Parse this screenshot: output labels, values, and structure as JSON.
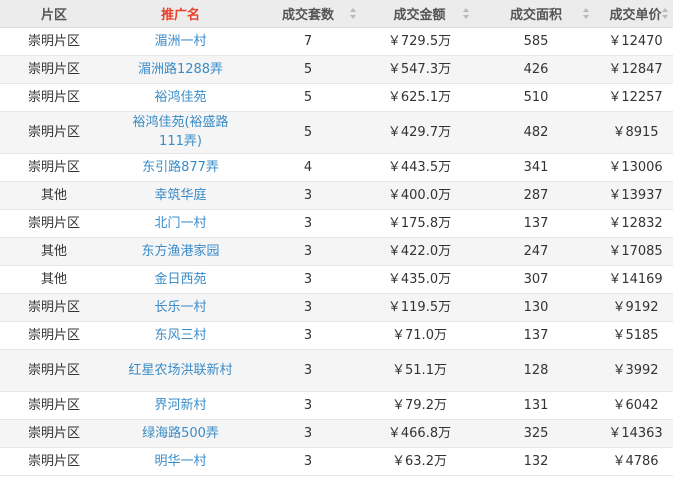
{
  "headers": {
    "district": "片区",
    "name": "推广名",
    "count": "成交套数",
    "amount": "成交金额",
    "area": "成交面积",
    "unit_price": "成交单价"
  },
  "colors": {
    "highlight_header": "#e8412c",
    "link": "#3a8cc8",
    "header_bg": "#ececec"
  },
  "rows": [
    {
      "district": "崇明片区",
      "name": "湄洲一村",
      "count": "7",
      "amount": "￥729.5万",
      "area": "585",
      "unit_price": "￥12470"
    },
    {
      "district": "崇明片区",
      "name": "湄洲路1288弄",
      "count": "5",
      "amount": "￥547.3万",
      "area": "426",
      "unit_price": "￥12847"
    },
    {
      "district": "崇明片区",
      "name": "裕鸿佳苑",
      "count": "5",
      "amount": "￥625.1万",
      "area": "510",
      "unit_price": "￥12257"
    },
    {
      "district": "崇明片区",
      "name": "裕鸿佳苑(裕盛路111弄)",
      "count": "5",
      "amount": "￥429.7万",
      "area": "482",
      "unit_price": "￥8915"
    },
    {
      "district": "崇明片区",
      "name": "东引路877弄",
      "count": "4",
      "amount": "￥443.5万",
      "area": "341",
      "unit_price": "￥13006"
    },
    {
      "district": "其他",
      "name": "幸筑华庭",
      "count": "3",
      "amount": "￥400.0万",
      "area": "287",
      "unit_price": "￥13937"
    },
    {
      "district": "崇明片区",
      "name": "北门一村",
      "count": "3",
      "amount": "￥175.8万",
      "area": "137",
      "unit_price": "￥12832"
    },
    {
      "district": "其他",
      "name": "东方渔港家园",
      "count": "3",
      "amount": "￥422.0万",
      "area": "247",
      "unit_price": "￥17085"
    },
    {
      "district": "其他",
      "name": "金日西苑",
      "count": "3",
      "amount": "￥435.0万",
      "area": "307",
      "unit_price": "￥14169"
    },
    {
      "district": "崇明片区",
      "name": "长乐一村",
      "count": "3",
      "amount": "￥119.5万",
      "area": "130",
      "unit_price": "￥9192"
    },
    {
      "district": "崇明片区",
      "name": "东风三村",
      "count": "3",
      "amount": "￥71.0万",
      "area": "137",
      "unit_price": "￥5185"
    },
    {
      "district": "崇明片区",
      "name": "红星农场洪联新村",
      "count": "3",
      "amount": "￥51.1万",
      "area": "128",
      "unit_price": "￥3992"
    },
    {
      "district": "崇明片区",
      "name": "界河新村",
      "count": "3",
      "amount": "￥79.2万",
      "area": "131",
      "unit_price": "￥6042"
    },
    {
      "district": "崇明片区",
      "name": "绿海路500弄",
      "count": "3",
      "amount": "￥466.8万",
      "area": "325",
      "unit_price": "￥14363"
    },
    {
      "district": "崇明片区",
      "name": "明华一村",
      "count": "3",
      "amount": "￥63.2万",
      "area": "132",
      "unit_price": "￥4786"
    }
  ]
}
